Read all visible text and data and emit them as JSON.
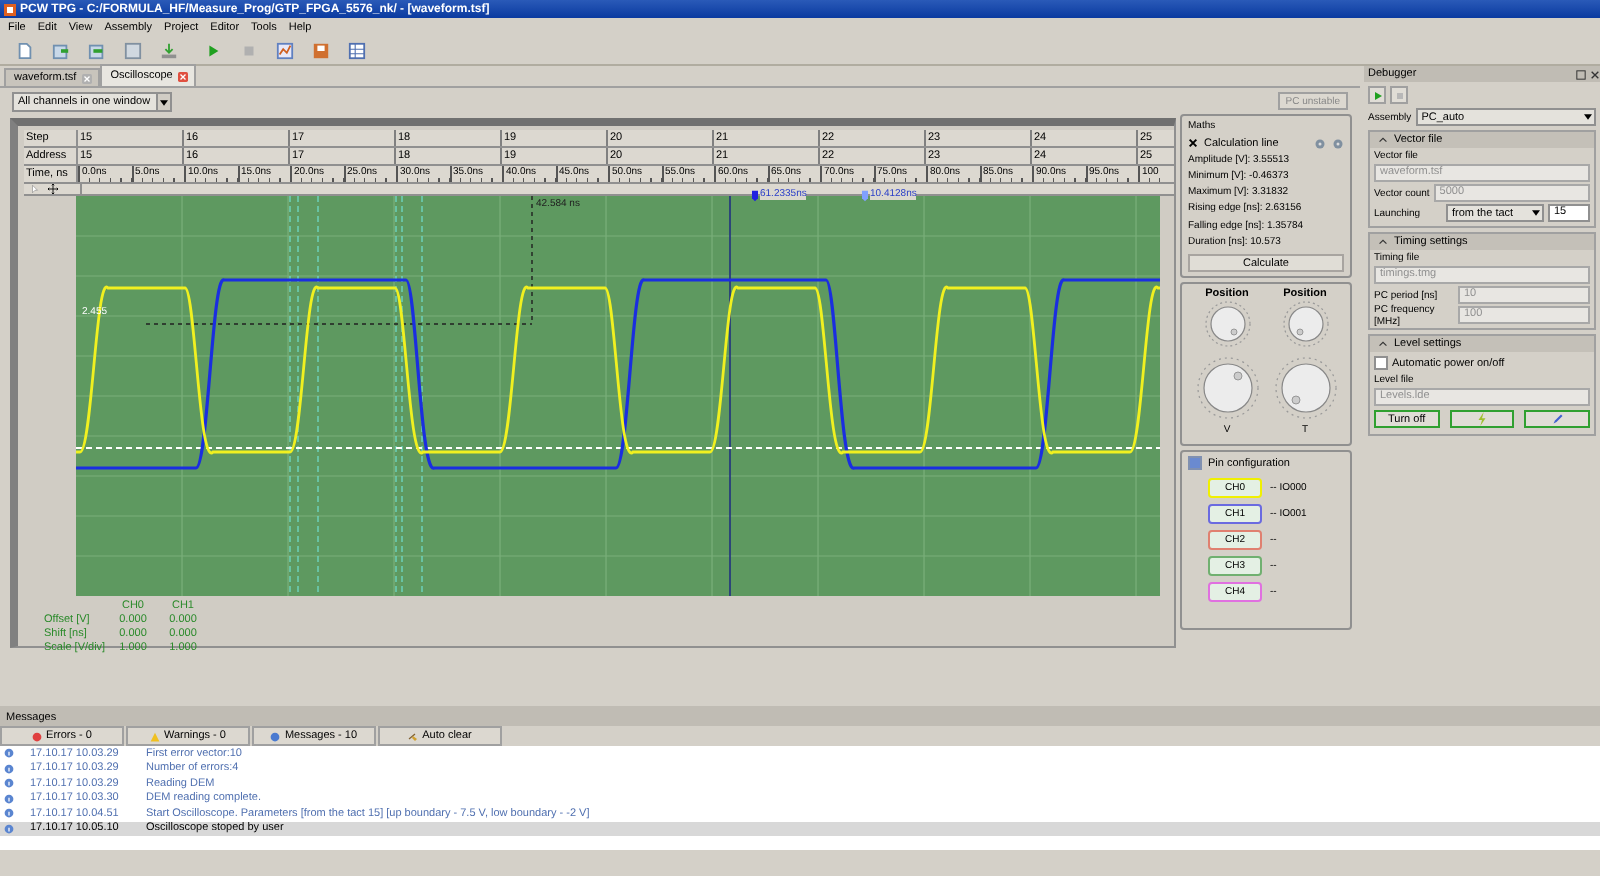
{
  "window": {
    "title": "PCW TPG - C:/FORMULA_HF/Measure_Prog/GTP_FPGA_5576_nk/ - [waveform.tsf]"
  },
  "menu": [
    "File",
    "Edit",
    "View",
    "Assembly",
    "Project",
    "Editor",
    "Tools",
    "Help"
  ],
  "tabs": [
    {
      "label": "waveform.tsf",
      "selected": false
    },
    {
      "label": "Oscilloscope",
      "selected": true
    }
  ],
  "view_select": {
    "value": "All channels in one window"
  },
  "pc_unstable_button": {
    "label": "PC unstable",
    "disabled": true
  },
  "scope": {
    "step_label": "Step",
    "address_label": "Address",
    "time_label": "Time, ns",
    "steps": [
      "15",
      "16",
      "17",
      "18",
      "19",
      "20",
      "21",
      "22",
      "23",
      "24",
      "25"
    ],
    "addresses": [
      "15",
      "16",
      "17",
      "18",
      "19",
      "20",
      "21",
      "22",
      "23",
      "24",
      "25"
    ],
    "time_ticks": [
      "0.0ns",
      "5.0ns",
      "10.0ns",
      "15.0ns",
      "20.0ns",
      "25.0ns",
      "30.0ns",
      "35.0ns",
      "40.0ns",
      "45.0ns",
      "50.0ns",
      "55.0ns",
      "60.0ns",
      "65.0ns",
      "70.0ns",
      "75.0ns",
      "80.0ns",
      "85.0ns",
      "90.0ns",
      "95.0ns",
      "100"
    ],
    "markers": [
      {
        "label": "61.2335ns",
        "color": "#2020e0"
      },
      {
        "label": "10.4128ns",
        "color": "#80a0ff"
      }
    ],
    "cursor_time": "42.584 ns",
    "cursor_level": "2.455",
    "legend": {
      "columns": [
        "CH0",
        "CH1"
      ],
      "rows": [
        {
          "label": "Offset [V]",
          "values": [
            "0.000",
            "0.000"
          ]
        },
        {
          "label": "Shift [ns]",
          "values": [
            "0.000",
            "0.000"
          ]
        },
        {
          "label": "Scale [V/div]",
          "values": [
            "1.000",
            "1.000"
          ]
        }
      ]
    }
  },
  "maths": {
    "title": "Maths",
    "calculation_line": {
      "label": "Calculation line",
      "checked": true
    },
    "readings": [
      "Amplitude [V]: 3.55513",
      "Minimum [V]: -0.46373",
      "Maximum [V]: 3.31832",
      "Rising edge [ns]: 2.63156",
      "Falling edge [ns]: 1.35784",
      "Duration [ns]: 10.573"
    ],
    "calculate_button": "Calculate"
  },
  "knobs": {
    "position_labels": [
      "Position",
      "Position"
    ],
    "axis_labels": [
      "V",
      "T"
    ]
  },
  "pin_configuration": {
    "title": "Pin configuration",
    "checked": true,
    "pins": [
      {
        "label": "CH0",
        "color": "#f0f000",
        "value": "-- IO000"
      },
      {
        "label": "CH1",
        "color": "#6a6ae0",
        "value": "-- IO001"
      },
      {
        "label": "CH2",
        "color": "#e08070",
        "value": "--"
      },
      {
        "label": "CH3",
        "color": "#70b070",
        "value": "--"
      },
      {
        "label": "CH4",
        "color": "#e070e0",
        "value": "--"
      }
    ]
  },
  "debugger": {
    "title": "Debugger",
    "assembly_label": "Assembly",
    "assembly": "PC_auto",
    "vector_section": {
      "title": "Vector file",
      "expanded": true,
      "file_label": "Vector file",
      "file": "waveform.tsf",
      "count_label": "Vector count",
      "count": "5000",
      "launching_label": "Launching",
      "launching": "from the tact",
      "launching_step": "15"
    },
    "timing_section": {
      "title": "Timing settings",
      "expanded": true,
      "file_label": "Timing file",
      "file": "timings.tmg",
      "period_label": "PC period [ns]",
      "period": "10",
      "frequency_label": "PC frequency [MHz]",
      "frequency": "100"
    },
    "level_section": {
      "title": "Level settings",
      "expanded": true,
      "auto_power": {
        "label": "Automatic power on/off",
        "checked": false
      },
      "file_label": "Level file",
      "file": "Levels.lde",
      "turn_off_button": "Turn off"
    }
  },
  "messages": {
    "title": "Messages",
    "filters": [
      {
        "kind": "error",
        "label": "Errors - 0"
      },
      {
        "kind": "warning",
        "label": "Warnings - 0"
      },
      {
        "kind": "info",
        "label": "Messages - 10"
      },
      {
        "kind": "clear",
        "label": "Auto clear"
      }
    ],
    "rows": [
      {
        "time": "17.10.17 10.03.29",
        "text": "First error vector:10",
        "selected": false
      },
      {
        "time": "17.10.17 10.03.29",
        "text": "Number of errors:4",
        "selected": false
      },
      {
        "time": "17.10.17 10.03.29",
        "text": "Reading DEM",
        "selected": false
      },
      {
        "time": "17.10.17 10.03.30",
        "text": "DEM reading complete.",
        "selected": false
      },
      {
        "time": "17.10.17 10.04.51",
        "text": "Start Oscilloscope. Parameters [from the tact 15] [up boundary - 7.5 V, low boundary - -2 V]",
        "selected": false
      },
      {
        "time": "17.10.17 10.05.10",
        "text": "Oscilloscope stoped by user",
        "selected": true
      }
    ]
  }
}
